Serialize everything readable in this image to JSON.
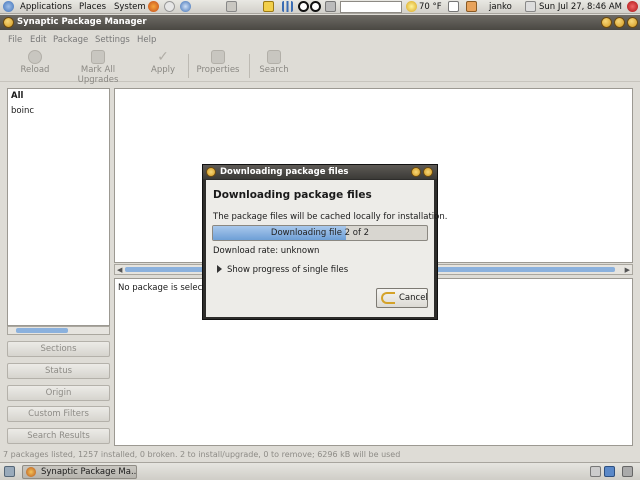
{
  "top_panel": {
    "applications": "Applications",
    "places": "Places",
    "system": "System",
    "temperature": "70 °F",
    "user": "janko",
    "clock": "Sun Jul 27,  8:46 AM"
  },
  "window": {
    "title": "Synaptic Package Manager",
    "menus": [
      "File",
      "Edit",
      "Package",
      "Settings",
      "Help"
    ],
    "toolbar": {
      "reload": "Reload",
      "mark_all_upgrades": "Mark All Upgrades",
      "apply": "Apply",
      "properties": "Properties",
      "search": "Search"
    }
  },
  "left_pane": {
    "items": [
      "All",
      "boinc"
    ]
  },
  "filter_buttons": {
    "sections": "Sections",
    "status": "Status",
    "origin": "Origin",
    "custom_filters": "Custom Filters",
    "search_results": "Search Results"
  },
  "desc_pane": {
    "text": "No package is selecte"
  },
  "statusbar": {
    "text": "7 packages listed, 1257 installed, 0 broken. 2 to install/upgrade, 0 to remove; 6296 kB will be used"
  },
  "taskbar": {
    "task": "Synaptic Package Ma..."
  },
  "dialog": {
    "title": "Downloading package files",
    "heading": "Downloading package files",
    "info": "The package files will be cached locally for installation.",
    "progress_text": "Downloading file 2 of 2",
    "progress_fraction": 0.62,
    "rate": "Download rate: unknown",
    "expander": "Show progress of single files",
    "cancel": "Cancel"
  },
  "colors": {
    "progress_fill": "#6e9fd6",
    "title_bar": "#4a4843",
    "accent_icon": "#d49a20"
  }
}
